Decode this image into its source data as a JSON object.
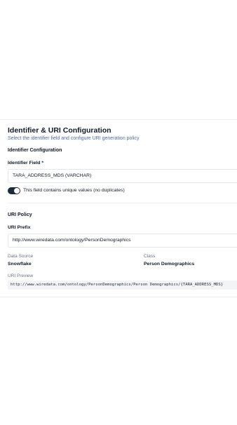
{
  "header": {
    "title": "Identifier & URI Configuration",
    "subtitle": "Select the identifier field and configure URI generation policy"
  },
  "identifier_config": {
    "heading": "Identifier Configuration",
    "field_label": "Identifier Field *",
    "field_value": "TARA_ADDRESS_MDS (VARCHAR)",
    "unique_toggle_on": true,
    "unique_toggle_label": "This field contains unique values (no duplicates)"
  },
  "uri_policy": {
    "heading": "URI Policy",
    "prefix_label": "URI Prefix",
    "prefix_value": "http://www.wiredata.com/ontology/PersonDemographics",
    "data_source_label": "Data Source",
    "data_source_value": "Snowflake",
    "class_label": "Class",
    "class_value": "Person Demographics",
    "preview_label": "URI Preview",
    "preview_value": "http://www.wiredata.com/ontology/PersonDemographics/Person Demographics/{TARA_ADDRESS_MDS}"
  },
  "colors": {
    "subtitle": "#4f6aa8",
    "toggle_on": "#1f2937",
    "preview_bg": "#f3f4f6"
  }
}
